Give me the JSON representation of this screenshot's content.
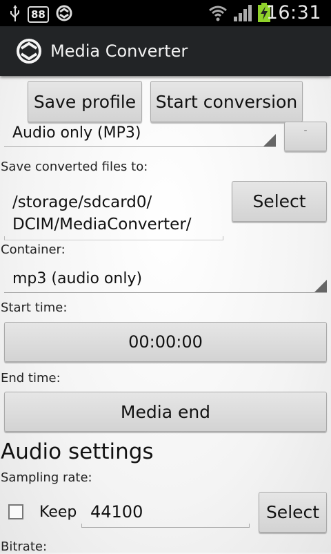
{
  "status_bar": {
    "icons_left": [
      "usb-icon",
      "notification-badge",
      "sync-icon"
    ],
    "badge_text": "88",
    "icons_right": [
      "wifi-icon",
      "signal-icon",
      "battery-charging-icon"
    ],
    "time": "16:31"
  },
  "action_bar": {
    "app_icon": "media-converter-logo",
    "title": "Media Converter"
  },
  "toolbar": {
    "save_profile": "Save profile",
    "start_conversion": "Start conversion"
  },
  "profile": {
    "selected": "Audio only (MP3)",
    "remove_label": "-"
  },
  "output": {
    "label": "Save converted files to:",
    "path_line1": "/storage/sdcard0/",
    "path_line2": "DCIM/MediaConverter/",
    "select_label": "Select"
  },
  "container": {
    "label": "Container:",
    "selected": "mp3 (audio only)"
  },
  "start_time": {
    "label": "Start time:",
    "value": "00:00:00"
  },
  "end_time": {
    "label": "End time:",
    "value": "Media end"
  },
  "audio": {
    "heading": "Audio settings",
    "sampling_label": "Sampling rate:",
    "keep_label": "Keep",
    "keep_checked": false,
    "sampling_value": "44100",
    "select_label": "Select",
    "bitrate_label": "Bitrate:"
  }
}
